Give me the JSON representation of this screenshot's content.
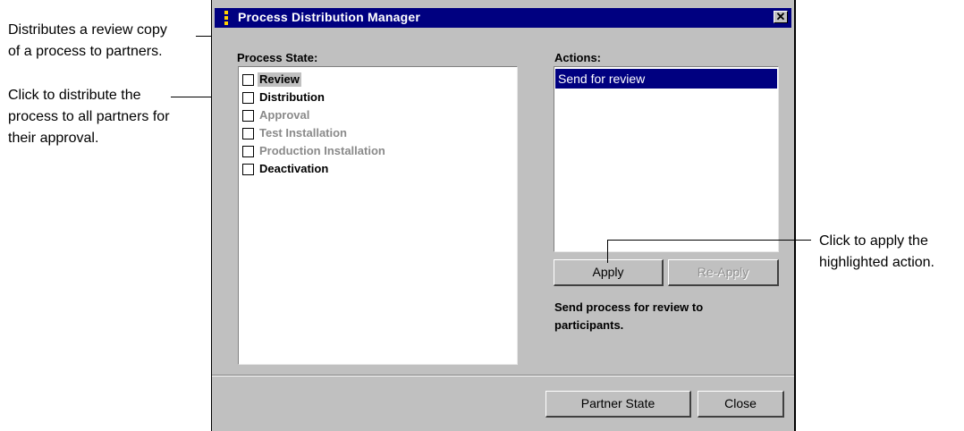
{
  "callouts": {
    "review": [
      "Distributes a review copy",
      "of a process to partners."
    ],
    "distribution": [
      "Click to distribute the",
      "process to all partners for",
      "their approval."
    ],
    "apply": [
      "Click to apply the",
      "highlighted action."
    ]
  },
  "window": {
    "title": "Process Distribution Manager",
    "close_label": "✕"
  },
  "process_state": {
    "label": "Process State:",
    "items": [
      {
        "label": "Review",
        "enabled": true,
        "selected": true
      },
      {
        "label": "Distribution",
        "enabled": true,
        "selected": false
      },
      {
        "label": "Approval",
        "enabled": false,
        "selected": false
      },
      {
        "label": "Test Installation",
        "enabled": false,
        "selected": false
      },
      {
        "label": "Production Installation",
        "enabled": false,
        "selected": false
      },
      {
        "label": "Deactivation",
        "enabled": true,
        "selected": false
      }
    ]
  },
  "actions": {
    "label": "Actions:",
    "items": [
      "Send for review"
    ],
    "apply_label": "Apply",
    "reapply_label": "Re-Apply",
    "description": "Send process for review to participants."
  },
  "footer": {
    "partner_state_label": "Partner State",
    "close_label": "Close"
  },
  "colors": {
    "title_bar": "#000080",
    "selection": "#000080",
    "window_face": "#c0c0c0",
    "disabled_text": "#8a8a8a"
  }
}
